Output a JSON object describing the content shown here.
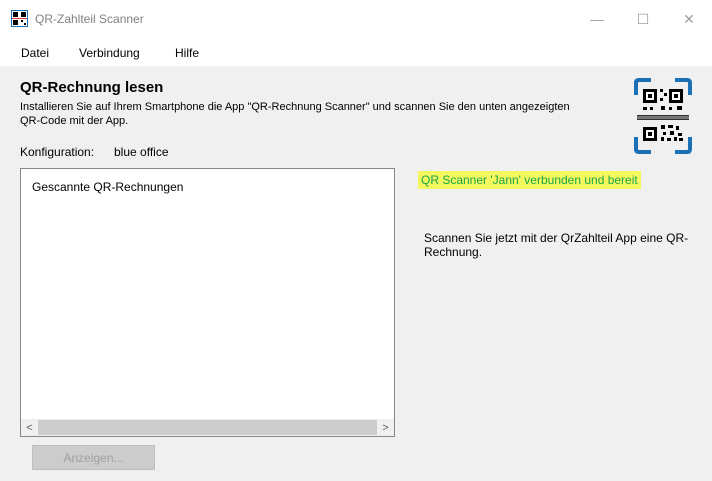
{
  "window": {
    "title": "QR-Zahlteil Scanner",
    "icon": "qr-app-icon",
    "controls": {
      "minimize": "—",
      "maximize": "☐",
      "close": "✕"
    }
  },
  "menu": {
    "items": [
      "Datei",
      "Verbindung",
      "Hilfe"
    ]
  },
  "main": {
    "heading": "QR-Rechnung lesen",
    "instructions": "Installieren Sie auf Ihrem Smartphone die App \"QR-Rechnung Scanner\" und scannen Sie den unten angezeigten QR-Code mit der App.",
    "config_label": "Konfiguration:",
    "config_value": "blue office",
    "list_header": "Gescannte QR-Rechnungen",
    "status": "QR Scanner 'Jann' verbunden und bereit",
    "scan_hint": "Scannen Sie jetzt mit der QrZahlteil App eine QR-Rechnung.",
    "show_button": "Anzeigen..."
  },
  "scrollbar": {
    "left_arrow": "<",
    "right_arrow": ">"
  },
  "colors": {
    "status_text": "#1aa64a",
    "status_highlight": "#f5f75e",
    "qr_frame": "#1a6fb5"
  }
}
